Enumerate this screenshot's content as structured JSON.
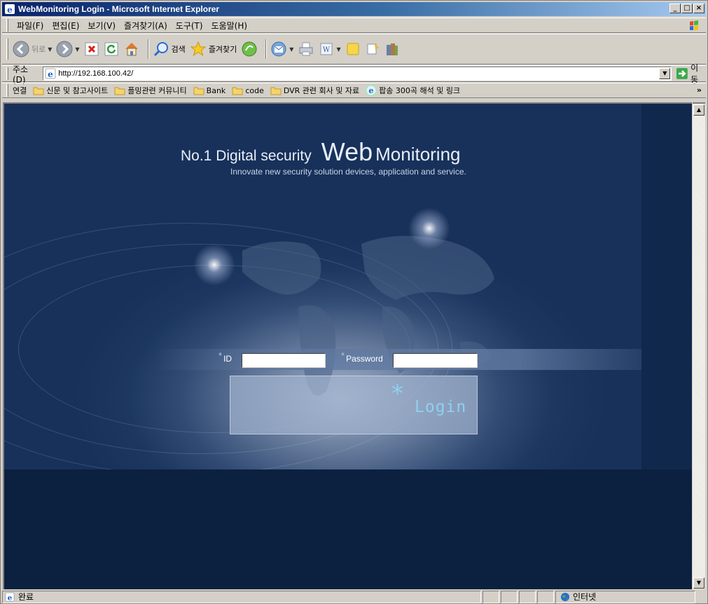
{
  "window": {
    "title": "WebMonitoring Login - Microsoft Internet Explorer",
    "min": "_",
    "max": "□",
    "close": "×"
  },
  "menu": [
    "파일(F)",
    "편집(E)",
    "보기(V)",
    "즐겨찾기(A)",
    "도구(T)",
    "도움말(H)"
  ],
  "toolbar": {
    "back": "뒤로",
    "search": "검색",
    "favorites": "즐겨찾기"
  },
  "address": {
    "label": "주소(D)",
    "url": "http://192.168.100.42/",
    "go": "이동"
  },
  "links": {
    "label": "연결",
    "items": [
      "신문 및 참고사이트",
      "플밍관련 커뮤니티",
      "Bank",
      "code",
      "DVR 관련 회사 및 자료",
      "팝송 300곡 해석 및 링크"
    ],
    "more": "»"
  },
  "page": {
    "headline_small": "No.1 Digital security",
    "headline_big": "Web",
    "headline_mid": "Monitoring",
    "tagline": "Innovate new security solution devices, application and service.",
    "id_label": "ID",
    "password_label": "Password",
    "star": "*",
    "id_value": "",
    "password_value": "",
    "login_label": "Login"
  },
  "status": {
    "text": "완료",
    "zone": "인터넷"
  }
}
